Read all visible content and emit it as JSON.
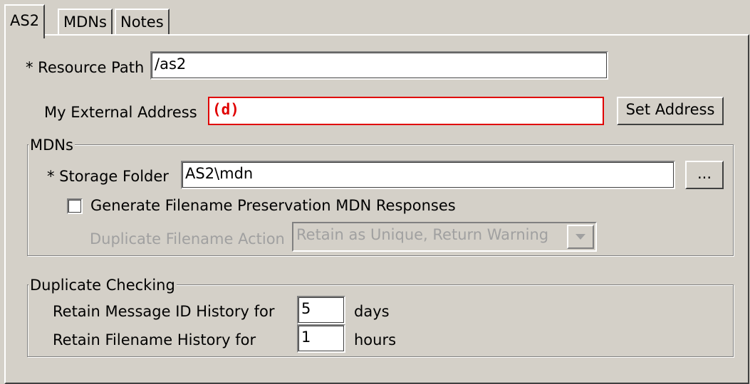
{
  "tabs": [
    {
      "label": "AS2",
      "active": true
    },
    {
      "label": "MDNs",
      "active": false
    },
    {
      "label": "Notes",
      "active": false
    }
  ],
  "resource_path": {
    "label": "* Resource Path",
    "value": "/as2"
  },
  "external_address": {
    "label": "My External Address",
    "value": "(d)",
    "error_color": "#e00000",
    "button_label": "Set Address"
  },
  "mdns_group": {
    "title": "MDNs",
    "storage_folder_label": "* Storage Folder",
    "storage_folder_value": "AS2\\mdn",
    "browse_label": "...",
    "checkbox_label": "Generate Filename Preservation MDN Responses",
    "checkbox_checked": false,
    "duplicate_action_label": "Duplicate Filename Action",
    "duplicate_action_value": "Retain as Unique, Return Warning"
  },
  "duplicate_group": {
    "title": "Duplicate Checking",
    "message_id_label": "Retain Message ID History for",
    "message_id_value": "5",
    "message_id_unit": "days",
    "filename_label": "Retain Filename History for",
    "filename_value": "1",
    "filename_unit": "hours"
  },
  "colors": {
    "background": "#d4d0c8",
    "disabled_text": "#a0a0a0",
    "error": "#e00000"
  }
}
